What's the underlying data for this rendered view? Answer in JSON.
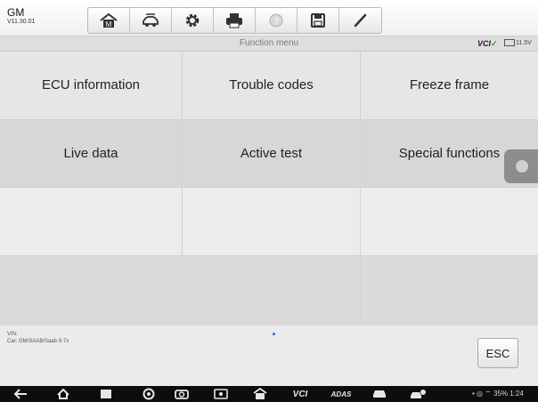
{
  "header": {
    "make": "GM",
    "version": "V11.30.01",
    "toolbar": [
      {
        "icon": "home-icon"
      },
      {
        "icon": "vehicle-swap-icon"
      },
      {
        "icon": "settings-gear-icon"
      },
      {
        "icon": "print-icon"
      },
      {
        "icon": "help-icon"
      },
      {
        "icon": "save-icon"
      },
      {
        "icon": "pen-icon"
      }
    ]
  },
  "subheader": {
    "title": "Function menu",
    "vci_label": "VCI",
    "battery_text": "11.5V"
  },
  "menu": [
    {
      "label": "ECU information"
    },
    {
      "label": "Trouble codes"
    },
    {
      "label": "Freeze frame"
    },
    {
      "label": "Live data"
    },
    {
      "label": "Active test"
    },
    {
      "label": "Special functions"
    },
    {
      "label": ""
    },
    {
      "label": ""
    },
    {
      "label": ""
    },
    {
      "label": ""
    },
    {
      "label": ""
    },
    {
      "label": ""
    }
  ],
  "footer": {
    "vin": "VIN:",
    "car": "Car: GM/SAAB/Saab 9-7x",
    "esc_label": "ESC"
  },
  "navbar": {
    "vci_text": "VCI",
    "adas_text": "ADAS",
    "status_text": "35% 1:24"
  }
}
